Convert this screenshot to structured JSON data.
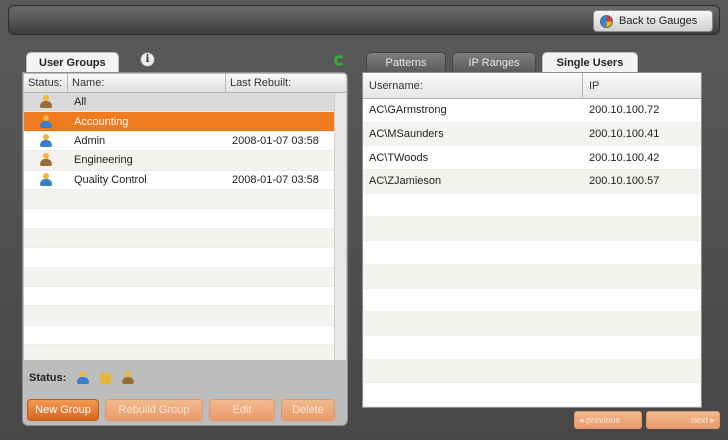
{
  "header": {
    "back_label": "Back to Gauges"
  },
  "left": {
    "tab_active": "User Groups",
    "columns": [
      "Status:",
      "Name:",
      "Last Rebuilt:"
    ],
    "rows": [
      {
        "name": "All",
        "rebuilt": ""
      },
      {
        "name": "Accounting",
        "rebuilt": ""
      },
      {
        "name": "Admin",
        "rebuilt": "2008-01-07 03:58"
      },
      {
        "name": "Engineering",
        "rebuilt": ""
      },
      {
        "name": "Quality Control",
        "rebuilt": "2008-01-07 03:58"
      }
    ],
    "status_label": "Status:",
    "buttons": {
      "new_group": "New Group",
      "rebuild_group": "Rebuild Group",
      "edit": "Edit",
      "delete": "Delete"
    }
  },
  "right": {
    "tabs": [
      "Patterns",
      "IP Ranges",
      "Single Users"
    ],
    "columns": [
      "Username:",
      "IP"
    ],
    "rows": [
      {
        "user": "AC\\GArmstrong",
        "ip": "200.10.100.72"
      },
      {
        "user": "AC\\MSaunders",
        "ip": "200.10.100.41"
      },
      {
        "user": "AC\\TWoods",
        "ip": "200.10.100.42"
      },
      {
        "user": "AC\\ZJamieson",
        "ip": "200.10.100.57"
      }
    ],
    "pager": {
      "previous": "◂ previous",
      "next": "next ▸"
    }
  },
  "colors": {
    "accent": "#f07a1e",
    "button": "#d8641f"
  }
}
